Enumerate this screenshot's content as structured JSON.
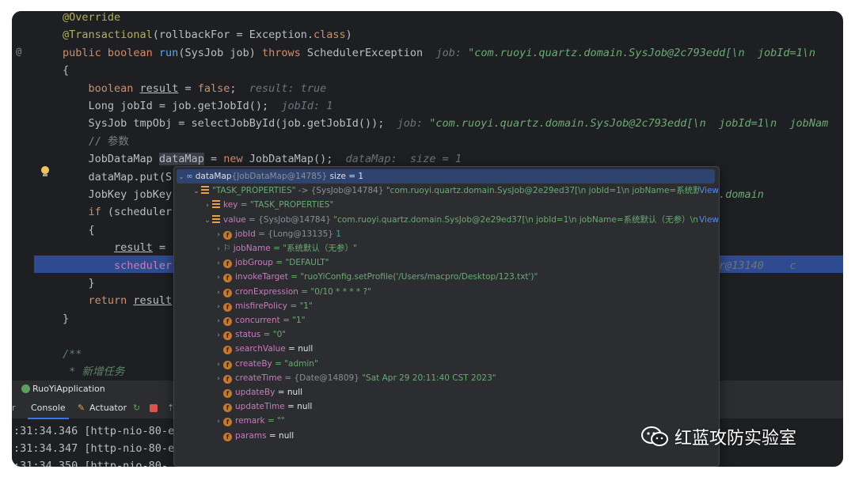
{
  "editor": {
    "lines": [
      {
        "parts": [
          {
            "c": "ann",
            "t": "@Override"
          }
        ]
      },
      {
        "parts": [
          {
            "c": "ann",
            "t": "@Transactional"
          },
          {
            "c": "",
            "t": "(rollbackFor = Exception."
          },
          {
            "c": "kw",
            "t": "class"
          },
          {
            "c": "",
            "t": ")"
          }
        ]
      },
      {
        "parts": [
          {
            "c": "kw",
            "t": "public boolean "
          },
          {
            "c": "fn",
            "t": "run"
          },
          {
            "c": "",
            "t": "(SysJob job) "
          },
          {
            "c": "kw",
            "t": "throws "
          },
          {
            "c": "",
            "t": "SchedulerException  "
          },
          {
            "c": "hint",
            "t": "job: "
          },
          {
            "c": "hint-str",
            "t": "\"com.ruoyi.quartz.domain.SysJob@2c793edd[\\n  jobId=1\\n"
          }
        ]
      },
      {
        "parts": [
          {
            "c": "",
            "t": "{"
          }
        ]
      },
      {
        "parts": [
          {
            "c": "kw",
            "t": "    boolean "
          },
          {
            "c": "ul",
            "t": "result"
          },
          {
            "c": "",
            "t": " = "
          },
          {
            "c": "kw",
            "t": "false"
          },
          {
            "c": "",
            "t": ";  "
          },
          {
            "c": "hint",
            "t": "result: true"
          }
        ]
      },
      {
        "parts": [
          {
            "c": "",
            "t": "    Long jobId = job.getJobId();  "
          },
          {
            "c": "hint",
            "t": "jobId: 1"
          }
        ]
      },
      {
        "parts": [
          {
            "c": "",
            "t": "    SysJob tmpObj = selectJobById(job.getJobId());  "
          },
          {
            "c": "hint",
            "t": "job: "
          },
          {
            "c": "hint-str",
            "t": "\"com.ruoyi.quartz.domain.SysJob@2c793edd[\\n  jobId=1\\n  jobNam"
          }
        ]
      },
      {
        "parts": [
          {
            "c": "cm",
            "t": "    // 参数"
          }
        ]
      },
      {
        "parts": [
          {
            "c": "",
            "t": "    JobDataMap "
          },
          {
            "c": "sel",
            "t": "dataMap"
          },
          {
            "c": "",
            "t": " = "
          },
          {
            "c": "kw",
            "t": "new "
          },
          {
            "c": "",
            "t": "JobDataMap();  "
          },
          {
            "c": "hint",
            "t": "dataMap:  size = 1"
          }
        ]
      },
      {
        "parts": [
          {
            "c": "",
            "t": "    dataMap.put(S"
          }
        ]
      },
      {
        "parts": [
          {
            "c": "",
            "t": "    JobKey jobKey"
          },
          {
            "c": "",
            "t": "                                                                          "
          },
          {
            "c": "hint-str",
            "t": "uoyi.quartz.domain"
          }
        ]
      },
      {
        "parts": [
          {
            "c": "kw",
            "t": "    if "
          },
          {
            "c": "",
            "t": "(scheduler"
          }
        ]
      },
      {
        "parts": [
          {
            "c": "",
            "t": "    {"
          }
        ]
      },
      {
        "parts": [
          {
            "c": "",
            "t": "        "
          },
          {
            "c": "ul",
            "t": "result"
          },
          {
            "c": "",
            "t": " ="
          }
        ]
      },
      {
        "parts": [
          {
            "c": "field",
            "t": "        scheduler"
          },
          {
            "c": "",
            "t": "                                                                              "
          },
          {
            "c": "hint",
            "t": "cheduler@13140    c"
          }
        ]
      },
      {
        "parts": [
          {
            "c": "",
            "t": "    }"
          }
        ]
      },
      {
        "parts": [
          {
            "c": "kw",
            "t": "    return "
          },
          {
            "c": "ul",
            "t": "result"
          }
        ]
      },
      {
        "parts": [
          {
            "c": "",
            "t": "}"
          }
        ]
      },
      {
        "parts": [
          {
            "c": "",
            "t": ""
          }
        ]
      },
      {
        "parts": [
          {
            "c": "docc",
            "t": "/**"
          }
        ]
      },
      {
        "parts": [
          {
            "c": "docc",
            "t": " * 新增任务"
          }
        ]
      }
    ]
  },
  "gutter": {
    "override_mark": "@"
  },
  "run": {
    "app_name": "RuoYiApplication"
  },
  "tool_tabs": {
    "console": "Console",
    "actuator": "Actuator"
  },
  "console": {
    "lines": [
      ":31:34.346 [http-nio-80-e",
      ":31:34.347 [http-nio-80-e",
      ":31:34.350 [http-nio-80-"
    ]
  },
  "debug_popup": {
    "rows": [
      {
        "indent": 0,
        "arrow": "⌄",
        "icon": "oo",
        "name": "dataMap",
        "type": "{JobDataMap@14785}",
        "value": " size = 1",
        "view": ""
      },
      {
        "indent": 1,
        "arrow": "⌄",
        "icon": "list",
        "name": "\"TASK_PROPERTIES\"",
        "type": " -> {SysJob@14784}",
        "value": " \"com.ruoyi.quartz.domain.SysJob@2e29ed37[\\n  jobId=1\\n  jobName=系统默...",
        "view": "View"
      },
      {
        "indent": 2,
        "arrow": "›",
        "icon": "list",
        "name": "key",
        "type": "",
        "value": " = \"TASK_PROPERTIES\"",
        "view": ""
      },
      {
        "indent": 2,
        "arrow": "⌄",
        "icon": "list",
        "name": "value",
        "type": " = {SysJob@14784}",
        "value": " \"com.ruoyi.quartz.domain.SysJob@2e29ed37[\\n  jobId=1\\n  jobName=系统默认（无参）\\n ...",
        "view": "View"
      },
      {
        "indent": 3,
        "arrow": "›",
        "icon": "f",
        "name": "jobId",
        "type": " = {Long@13135}",
        "value": " 1",
        "view": ""
      },
      {
        "indent": 3,
        "arrow": "›",
        "icon": "flag",
        "name": "jobName",
        "type": "",
        "value": " = \"系统默认（无参）\"",
        "view": ""
      },
      {
        "indent": 3,
        "arrow": "›",
        "icon": "f",
        "name": "jobGroup",
        "type": "",
        "value": " = \"DEFAULT\"",
        "view": ""
      },
      {
        "indent": 3,
        "arrow": "›",
        "icon": "f",
        "name": "invokeTarget",
        "type": "",
        "value": " = \"ruoYiConfig.setProfile('/Users/macpro/Desktop/123.txt')\"",
        "view": ""
      },
      {
        "indent": 3,
        "arrow": "›",
        "icon": "f",
        "name": "cronExpression",
        "type": "",
        "value": " = \"0/10 * * * * ?\"",
        "view": ""
      },
      {
        "indent": 3,
        "arrow": "›",
        "icon": "f",
        "name": "misfirePolicy",
        "type": "",
        "value": " = \"1\"",
        "view": ""
      },
      {
        "indent": 3,
        "arrow": "›",
        "icon": "f",
        "name": "concurrent",
        "type": "",
        "value": " = \"1\"",
        "view": ""
      },
      {
        "indent": 3,
        "arrow": "›",
        "icon": "f",
        "name": "status",
        "type": "",
        "value": " = \"0\"",
        "view": ""
      },
      {
        "indent": 3,
        "arrow": "",
        "icon": "f",
        "name": "searchValue",
        "type": "",
        "value": " = null",
        "view": ""
      },
      {
        "indent": 3,
        "arrow": "›",
        "icon": "f",
        "name": "createBy",
        "type": "",
        "value": " = \"admin\"",
        "view": ""
      },
      {
        "indent": 3,
        "arrow": "›",
        "icon": "f",
        "name": "createTime",
        "type": " = {Date@14809}",
        "value": " \"Sat Apr 29 20:11:40 CST 2023\"",
        "view": ""
      },
      {
        "indent": 3,
        "arrow": "",
        "icon": "f",
        "name": "updateBy",
        "type": "",
        "value": " = null",
        "view": ""
      },
      {
        "indent": 3,
        "arrow": "",
        "icon": "f",
        "name": "updateTime",
        "type": "",
        "value": " = null",
        "view": ""
      },
      {
        "indent": 3,
        "arrow": "›",
        "icon": "f",
        "name": "remark",
        "type": "",
        "value": " = \"\"",
        "view": ""
      },
      {
        "indent": 3,
        "arrow": "",
        "icon": "f",
        "name": "params",
        "type": "",
        "value": " = null",
        "view": ""
      }
    ]
  },
  "watermark": {
    "text": "红蓝攻防实验室"
  }
}
